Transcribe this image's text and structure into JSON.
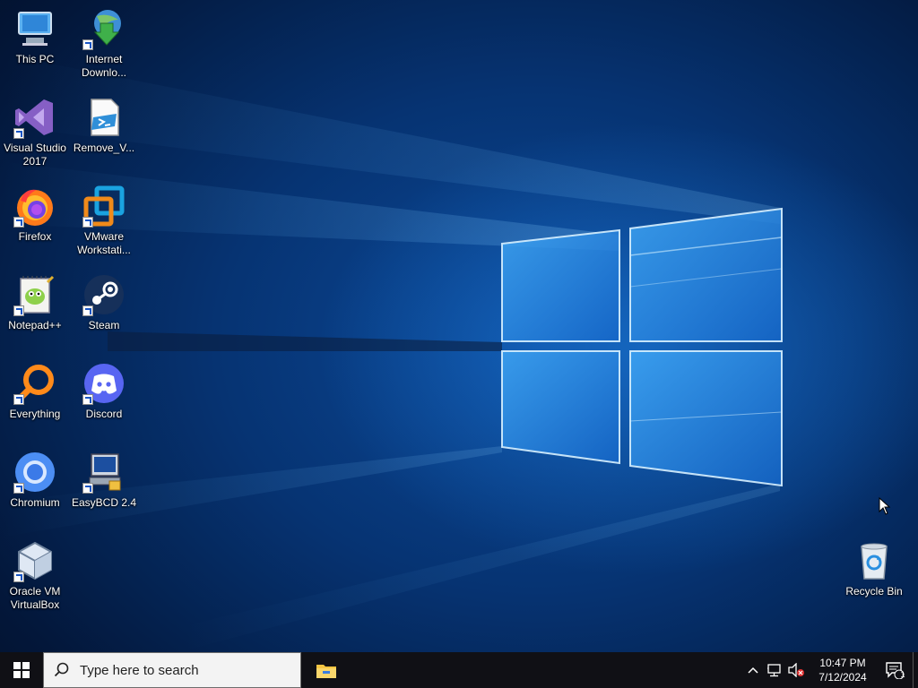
{
  "desktop": {
    "icons": [
      {
        "label": "This PC",
        "icon": "computer-icon"
      },
      {
        "label": "Internet Downlo...",
        "icon": "idm-icon"
      },
      {
        "label": "Visual Studio 2017",
        "icon": "visual-studio-icon"
      },
      {
        "label": "Remove_V...",
        "icon": "powershell-script-icon"
      },
      {
        "label": "Firefox",
        "icon": "firefox-icon"
      },
      {
        "label": "VMware Workstati...",
        "icon": "vmware-icon"
      },
      {
        "label": "Notepad++",
        "icon": "notepad-plus-plus-icon"
      },
      {
        "label": "Steam",
        "icon": "steam-icon"
      },
      {
        "label": "Everything",
        "icon": "everything-search-icon"
      },
      {
        "label": "Discord",
        "icon": "discord-icon"
      },
      {
        "label": "Chromium",
        "icon": "chromium-icon"
      },
      {
        "label": "EasyBCD 2.4",
        "icon": "easybcd-icon"
      },
      {
        "label": "Oracle VM VirtualBox",
        "icon": "virtualbox-icon"
      },
      {
        "label": "Recycle Bin",
        "icon": "recycle-bin-icon"
      }
    ]
  },
  "taskbar": {
    "search_placeholder": "Type here to search",
    "pinned": [
      "file-explorer-icon"
    ],
    "tray_icons": [
      "chevron-up-icon",
      "network-icon",
      "volume-muted-icon"
    ],
    "clock": {
      "time": "10:47 PM",
      "date": "7/12/2024"
    },
    "notification_count": "1"
  },
  "colors": {
    "taskbar": "#101015",
    "search_bg": "#f3f3f3",
    "accent": "#1a8cff"
  }
}
